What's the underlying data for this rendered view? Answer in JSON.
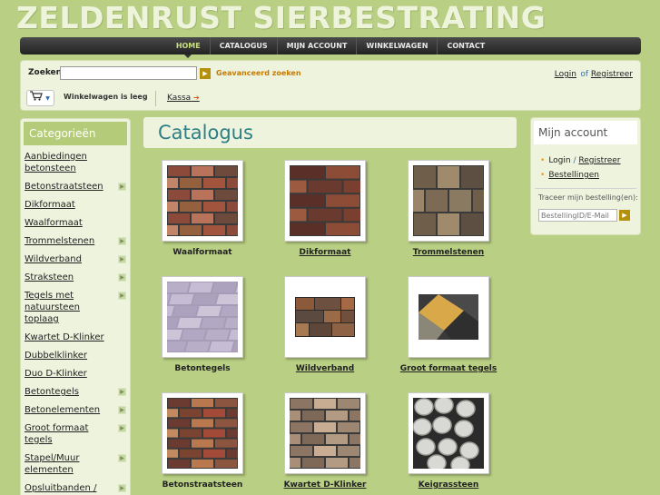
{
  "site_title": "ZELDENRUST SIERBESTRATING",
  "nav": [
    "HOME",
    "CATALOGUS",
    "MIJN ACCOUNT",
    "WINKELWAGEN",
    "CONTACT"
  ],
  "search": {
    "label": "Zoeken:",
    "value": "",
    "go_icon": "arrow-right-icon",
    "advanced_label": "Geavanceerd zoeken"
  },
  "auth": {
    "login": "Login",
    "of": "of",
    "register": "Registreer"
  },
  "cart": {
    "icon": "cart-icon",
    "status": "Winkelwagen is leeg",
    "checkout": "Kassa"
  },
  "categories": {
    "title": "Categorieën",
    "items": [
      {
        "label": "Aanbiedingen betonsteen",
        "has_sub": false
      },
      {
        "label": "Betonstraatsteen",
        "has_sub": true
      },
      {
        "label": "Dikformaat",
        "has_sub": false
      },
      {
        "label": "Waalformaat",
        "has_sub": false
      },
      {
        "label": "Trommelstenen",
        "has_sub": true
      },
      {
        "label": "Wildverband",
        "has_sub": true
      },
      {
        "label": "Straksteen",
        "has_sub": true
      },
      {
        "label": "Tegels met natuursteen toplaag",
        "has_sub": true
      },
      {
        "label": "Kwartet D-Klinker",
        "has_sub": false
      },
      {
        "label": "Dubbelklinker",
        "has_sub": false
      },
      {
        "label": "Duo D-Klinker",
        "has_sub": false
      },
      {
        "label": "Betontegels",
        "has_sub": true
      },
      {
        "label": "Betonelementen",
        "has_sub": true
      },
      {
        "label": "Groot formaat tegels",
        "has_sub": true
      },
      {
        "label": "Stapel/Muur elementen",
        "has_sub": true
      },
      {
        "label": "Opsluitbanden / Palissadebanden",
        "has_sub": true
      }
    ]
  },
  "catalog": {
    "title": "Catalogus",
    "products": [
      {
        "name": "Waalformaat",
        "underline": false
      },
      {
        "name": "Dikformaat",
        "underline": true
      },
      {
        "name": "Trommelstenen",
        "underline": true
      },
      {
        "name": "Betontegels",
        "underline": false
      },
      {
        "name": "Wildverband",
        "underline": true
      },
      {
        "name": "Groot formaat tegels",
        "underline": true
      },
      {
        "name": "Betonstraatsteen",
        "underline": false
      },
      {
        "name": "Kwartet D-Klinker",
        "underline": true
      },
      {
        "name": "Keigrassteen",
        "underline": true
      }
    ]
  },
  "account": {
    "title": "Mijn account",
    "login": "Login",
    "slash": "/",
    "register": "Registreer",
    "orders": "Bestellingen",
    "track_label": "Traceer mijn bestelling(en):",
    "track_placeholder": "BestellingID/E-Mail"
  }
}
